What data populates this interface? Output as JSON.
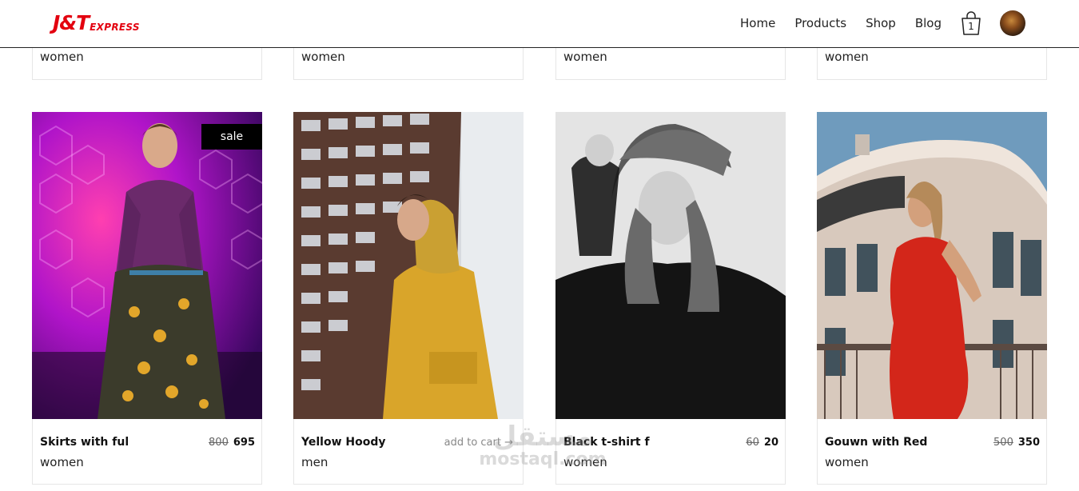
{
  "header": {
    "logo_main": "J&T",
    "logo_sub": "EXPRESS",
    "nav": [
      "Home",
      "Products",
      "Shop",
      "Blog"
    ],
    "cart_count": "1",
    "avatar_icon": "user-avatar"
  },
  "top_row": {
    "categories": [
      "women",
      "women",
      "women",
      "women"
    ]
  },
  "products": [
    {
      "title": "Skirts with ful",
      "category": "women",
      "old_price": "800",
      "price": "695",
      "badge": "sale"
    },
    {
      "title": "Yellow Hoody",
      "category": "men",
      "action": "add to cart →"
    },
    {
      "title": "Black t-shirt f",
      "category": "women",
      "old_price": "60",
      "price": "20"
    },
    {
      "title": "Gouwn with Red",
      "category": "women",
      "old_price": "500",
      "price": "350"
    }
  ],
  "watermark": {
    "arabic": "مستقل",
    "latin": "mostaql.com"
  },
  "colors": {
    "brand": "#e3000f",
    "sale_badge": "#000000"
  }
}
